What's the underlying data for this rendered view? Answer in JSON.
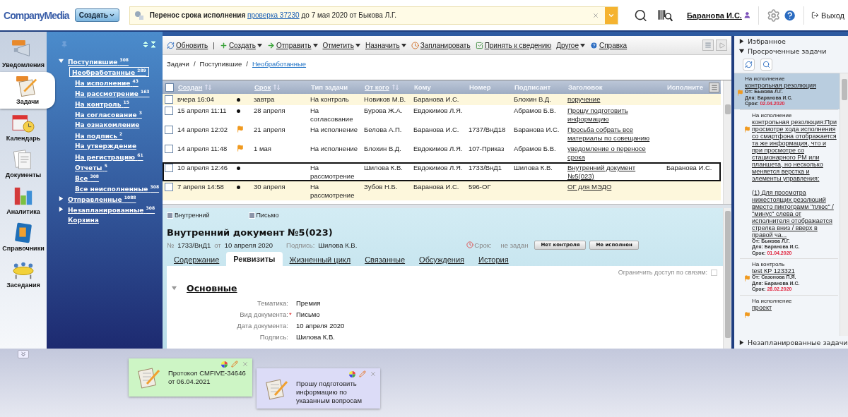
{
  "top_bar": {
    "logo": "CompanyMedia",
    "create_button": "Создать",
    "notification": {
      "title": "Перенос срока исполнения",
      "link": "проверка 37230",
      "rest": "до 7 мая 2020 от Быкова Л.Г."
    },
    "user": "Баранова И.С.",
    "logout": "Выход"
  },
  "nav": [
    {
      "label": "Уведомления",
      "selected": false
    },
    {
      "label": "Задачи",
      "selected": true
    },
    {
      "label": "Календарь",
      "selected": false
    },
    {
      "label": "Документы",
      "selected": false
    },
    {
      "label": "Аналитика",
      "selected": false
    },
    {
      "label": "Справочники",
      "selected": false
    },
    {
      "label": "Заседания",
      "selected": false
    }
  ],
  "tree": [
    {
      "label": "Поступившие",
      "count": "308",
      "expanded": true,
      "selected": false,
      "children": [
        {
          "label": "Необработанные",
          "count": "289",
          "selected": true
        },
        {
          "label": "На исполнение",
          "count": "43",
          "selected": false
        },
        {
          "label": "На рассмотрение",
          "count": "163",
          "selected": false
        },
        {
          "label": "На контроль",
          "count": "15",
          "selected": false
        },
        {
          "label": "На согласование",
          "count": "3",
          "selected": false
        },
        {
          "label": "На ознакомление",
          "selected": false
        },
        {
          "label": "На подпись",
          "count": "2",
          "selected": false
        },
        {
          "label": "На утверждение",
          "selected": false
        },
        {
          "label": "На регистрацию",
          "count": "61",
          "selected": false
        },
        {
          "label": "Отчеты",
          "count": "5",
          "selected": false
        },
        {
          "label": "Все",
          "count": "308",
          "selected": false
        },
        {
          "label": "Все неисполненные",
          "count": "308",
          "selected": false
        }
      ]
    },
    {
      "label": "Отправленные",
      "count": "1088",
      "expanded": false,
      "selected": false
    },
    {
      "label": "Незапланированные",
      "count": "308",
      "expanded": false,
      "selected": false
    },
    {
      "label": "Корзина",
      "selected": false
    }
  ],
  "toolbar": [
    {
      "kind": "button",
      "label": "Обновить"
    },
    {
      "kind": "separator",
      "label": "|"
    },
    {
      "kind": "dropdown",
      "label": "Создать"
    },
    {
      "kind": "dropdown",
      "label": "Отправить"
    },
    {
      "kind": "dropdown",
      "label": "Отметить"
    },
    {
      "kind": "dropdown",
      "label": "Назначить"
    },
    {
      "kind": "button",
      "label": "Запланировать"
    },
    {
      "kind": "button",
      "label": "Принять к сведению"
    },
    {
      "kind": "dropdown",
      "label": "Другое"
    },
    {
      "kind": "button",
      "label": "Справка"
    }
  ],
  "breadcrumb": [
    {
      "kind": "crumb",
      "text": "Задачи"
    },
    {
      "kind": "separator",
      "text": "/"
    },
    {
      "kind": "crumb",
      "text": "Поступившие"
    },
    {
      "kind": "separator",
      "text": "/"
    },
    {
      "kind": "link",
      "text": "Необработанные"
    }
  ],
  "table": {
    "select_all": {
      "checked": false
    },
    "columns": [
      {
        "label": "Создан",
        "sortable": true
      },
      {
        "label": "Срок",
        "sortable": true
      },
      {
        "label": "Тип задачи",
        "sortable": false
      },
      {
        "label": "От кого",
        "sortable": true
      },
      {
        "label": "Кому",
        "sortable": false
      },
      {
        "label": "Номер",
        "sortable": false
      },
      {
        "label": "Подписант",
        "sortable": false
      },
      {
        "label": "Заголовок",
        "sortable": false
      },
      {
        "label": "Исполните",
        "sortable": false
      }
    ],
    "rows": [
      {
        "checked": false,
        "highlighted": true,
        "selected": false,
        "created": "вчера 16:04",
        "flagged": false,
        "due": "завтра",
        "type": "На контроль",
        "from": "Новиков М.В.",
        "to": "Баранова И.С.",
        "signer": "Блохин В.Д.",
        "title": "поручение"
      },
      {
        "checked": false,
        "highlighted": false,
        "selected": false,
        "created": "15 апреля 11:11",
        "flagged": false,
        "due": "28 апреля",
        "type": "На согласование",
        "from": "Бурова Ж.А.",
        "to": "Евдокимов Л.Я.",
        "signer": "Абрамов Б.В.",
        "title": "Прошу подготовить информацию"
      },
      {
        "checked": false,
        "highlighted": false,
        "selected": false,
        "created": "14 апреля 12:02",
        "flagged": true,
        "due": "21 апреля",
        "type": "На исполнение",
        "from": "Белова А.П.",
        "to": "Баранова И.С.",
        "number": "1737/ВнД18",
        "signer": "Баранова И.С.",
        "title": "Просьба собрать все материалы по совещанию"
      },
      {
        "checked": false,
        "highlighted": false,
        "selected": false,
        "created": "14 апреля 11:48",
        "flagged": true,
        "due": "1 мая",
        "type": "На исполнение",
        "from": "Блохин В.Д.",
        "to": "Евдокимов Л.Я.",
        "number": "107-Приказ",
        "signer": "Абрамов Б.В.",
        "title": "уведомление о переносе срока"
      },
      {
        "checked": false,
        "highlighted": false,
        "selected": true,
        "created": "10 апреля 12:46",
        "flagged": false,
        "type": "На рассмотрение",
        "from": "Шилова К.В.",
        "to": "Евдокимов Л.Я.",
        "number": "1733/ВнД1",
        "signer": "Шилова К.В.",
        "title": "Внутренний документ №5(023)",
        "executor": "Баранова И.С."
      },
      {
        "checked": false,
        "highlighted": true,
        "selected": false,
        "created": "7 апреля 14:58",
        "flagged": false,
        "due": "30 апреля",
        "type": "На рассмотрение",
        "from": "Зубов Н.Б.",
        "to": "Баранова И.С.",
        "number": "596-ОГ",
        "title": "ОГ для МЭДО"
      }
    ]
  },
  "detail": {
    "tags": [
      "Внутренний",
      "Письмо"
    ],
    "title": "Внутренний документ №5(023)",
    "number_label": "№",
    "number": "1733/ВнД1",
    "date_label": "от",
    "date": "10 апреля 2020",
    "sign_label": "Подпись:",
    "signer": "Шилова К.В.",
    "due_label": "Срок:",
    "due": "не задан",
    "buttons": [
      "Нет контроля",
      "Не исполнен"
    ],
    "tabs": [
      {
        "label": "Содержание",
        "selected": false
      },
      {
        "label": "Реквизиты",
        "selected": true
      },
      {
        "label": "Жизненный цикл",
        "selected": false
      },
      {
        "label": "Связанные",
        "selected": false
      },
      {
        "label": "Обсуждения",
        "selected": false
      },
      {
        "label": "История",
        "selected": false
      }
    ],
    "restrict": {
      "label": "Ограничить доступ по связям:",
      "checked": false
    },
    "section": {
      "title": "Основные",
      "expanded": true
    },
    "fields": [
      {
        "label": "Тематика:",
        "value": "Премия"
      },
      {
        "label": "Вид документа:",
        "required_mark": "*",
        "value": "Письмо"
      },
      {
        "label": "Дата документа:",
        "value": "10 апреля 2020"
      },
      {
        "label": "Подпись:",
        "value": "Шилова К.В."
      }
    ]
  },
  "right_panel": {
    "favorites": {
      "label": "Избранное",
      "expanded": false
    },
    "overdue": {
      "label": "Просроченные задачи",
      "expanded": true,
      "tasks": [
        {
          "type": "На исполнение",
          "title": "контрольная резолюция",
          "from": "От: Быкова Л.Г.",
          "for": "Для: Баранова И.С.",
          "due_label": "Срок:",
          "due": "02.04.2020",
          "selected": true,
          "children": [
            {
              "type": "На исполнение",
              "title": "контрольная резолюция:При просмотре хода исполнения со смартфона отображается та же информация, что и при просмотре со стационарного РМ или планшета, но несколько меняется верстка и элементы управления:\n\n(1) Для просмотра нижестоящих резолюций вместо пиктограмм \"плюс\" / \"минус\" слева от исполнителя отображается стрелка вниз / вверх в правой ча...",
              "from": "От: Быкова Л.Г.",
              "for": "Для: Баранова И.С.",
              "due_label": "Срок:",
              "due": "01.04.2020",
              "selected": false
            },
            {
              "type": "На контроль",
              "title": "test КР 123321",
              "from": "От: Сазонова П.Я.",
              "for": "Для: Баранова И.С.",
              "due_label": "Срок:",
              "due": "28.02.2020",
              "selected": false
            },
            {
              "type": "На исполнение",
              "title": "проект",
              "selected": false
            }
          ]
        }
      ]
    },
    "unplanned": {
      "label": "Незапланированные задачи",
      "expanded": false
    }
  },
  "notes": [
    {
      "text": "Протокол CMFIVE-34646\nот 06.04.2021",
      "color": "#cdf5c5"
    },
    {
      "text": "Прошу подготовить\nинформацию по\nуказанным вопросам",
      "color": "#dcdcf7"
    }
  ]
}
